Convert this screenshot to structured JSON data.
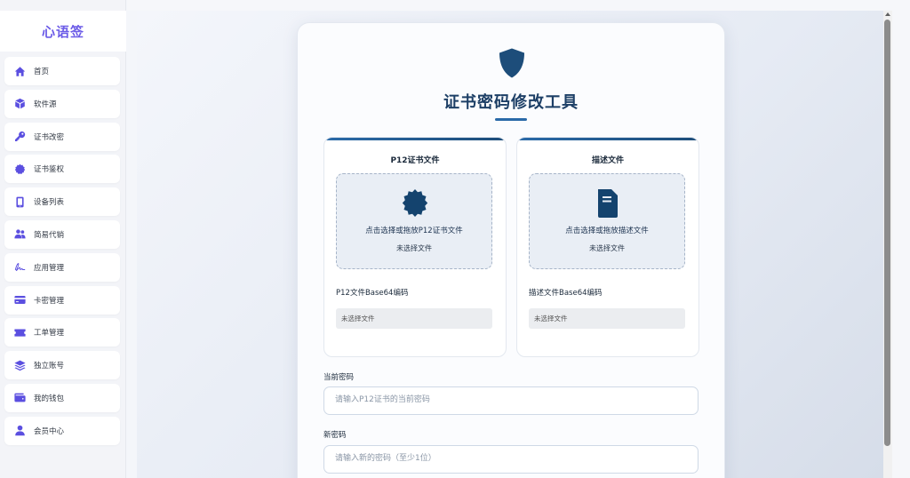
{
  "app": {
    "brand": "心语签"
  },
  "sidebar": {
    "items": [
      {
        "label": "首页",
        "icon": "home-icon"
      },
      {
        "label": "软件源",
        "icon": "cube-icon"
      },
      {
        "label": "证书改密",
        "icon": "key-icon"
      },
      {
        "label": "证书鉴权",
        "icon": "badge-icon"
      },
      {
        "label": "设备列表",
        "icon": "phone-icon"
      },
      {
        "label": "简易代销",
        "icon": "users-icon"
      },
      {
        "label": "应用管理",
        "icon": "signature-icon"
      },
      {
        "label": "卡密管理",
        "icon": "credit-card-icon"
      },
      {
        "label": "工单管理",
        "icon": "ticket-icon"
      },
      {
        "label": "独立账号",
        "icon": "layers-icon"
      },
      {
        "label": "我的钱包",
        "icon": "wallet-icon"
      },
      {
        "label": "会员中心",
        "icon": "user-icon"
      }
    ]
  },
  "main": {
    "title": "证书密码修改工具",
    "p12": {
      "title": "P12证书文件",
      "drop_text": "点击选择或拖放P12证书文件",
      "status": "未选择文件",
      "b64_label": "P12文件Base64编码",
      "b64_value": "未选择文件"
    },
    "profile": {
      "title": "描述文件",
      "drop_text": "点击选择或拖放描述文件",
      "status": "未选择文件",
      "b64_label": "描述文件Base64编码",
      "b64_value": "未选择文件"
    },
    "current_password": {
      "label": "当前密码",
      "placeholder": "请输入P12证书的当前密码"
    },
    "new_password": {
      "label": "新密码",
      "placeholder": "请输入新的密码（至少1位）"
    }
  },
  "colors": {
    "brand": "#6c5ce7",
    "accent": "#1d4d7a",
    "title": "#1d3f66"
  }
}
